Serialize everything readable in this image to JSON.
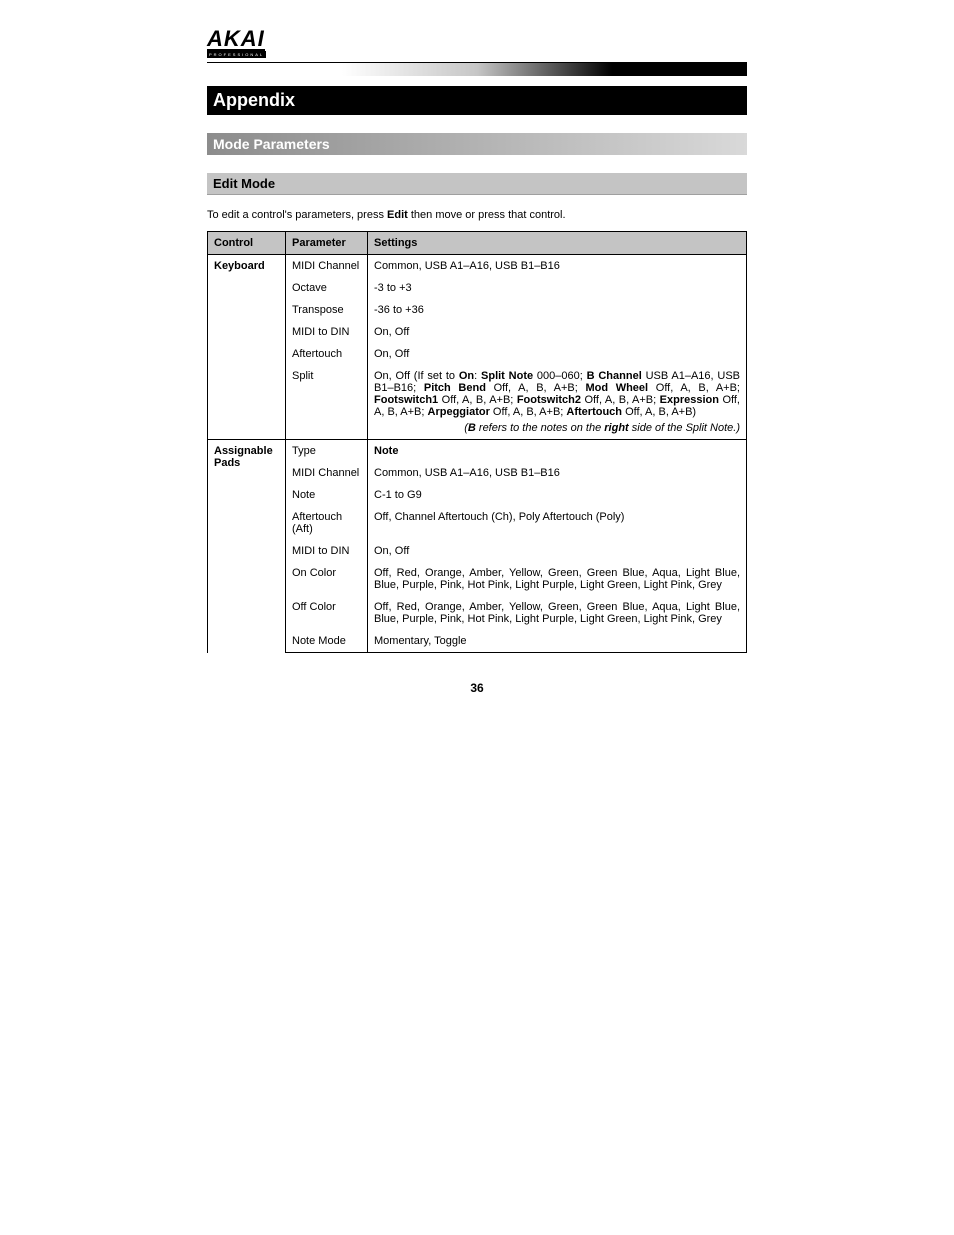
{
  "logo": {
    "main": "AKAI",
    "sub": "PROFESSIONAL"
  },
  "headings": {
    "appendix": "Appendix",
    "mode_parameters": "Mode Parameters",
    "edit_mode": "Edit Mode"
  },
  "intro": {
    "pre": "To edit a control's parameters, press ",
    "bold": "Edit",
    "post": " then move or press that control."
  },
  "table": {
    "headers": {
      "control": "Control",
      "parameter": "Parameter",
      "settings": "Settings"
    },
    "groups": [
      {
        "control": "Keyboard",
        "rows": [
          {
            "param": "MIDI Channel",
            "settings": "Common, USB A1–A16, USB B1–B16"
          },
          {
            "param": "Octave",
            "settings": "-3 to +3"
          },
          {
            "param": "Transpose",
            "settings": "-36 to +36"
          },
          {
            "param": "MIDI to DIN",
            "settings": "On, Off"
          },
          {
            "param": "Aftertouch",
            "settings": "On, Off"
          }
        ],
        "split": {
          "param": "Split",
          "segments": [
            {
              "t": "On, Off (If set to "
            },
            {
              "t": "On",
              "b": true
            },
            {
              "t": ": "
            },
            {
              "t": "Split Note",
              "b": true
            },
            {
              "t": " 000–060; "
            },
            {
              "t": "B Channel",
              "b": true
            },
            {
              "t": " USB A1–A16, USB B1–B16; "
            },
            {
              "t": "Pitch Bend",
              "b": true
            },
            {
              "t": " Off, A, B, A+B; "
            },
            {
              "t": "Mod Wheel",
              "b": true
            },
            {
              "t": " Off, A, B, A+B; "
            },
            {
              "t": "Footswitch1",
              "b": true
            },
            {
              "t": " Off, A, B, A+B; "
            },
            {
              "t": "Footswitch2",
              "b": true
            },
            {
              "t": " Off, A, B, A+B; "
            },
            {
              "t": "Expression",
              "b": true
            },
            {
              "t": " Off, A, B, A+B; "
            },
            {
              "t": "Arpeggiator",
              "b": true
            },
            {
              "t": " Off, A, B, A+B; "
            },
            {
              "t": "Aftertouch",
              "b": true
            },
            {
              "t": " Off, A, B, A+B)"
            }
          ],
          "note_segments": [
            {
              "t": "("
            },
            {
              "t": "B",
              "b": true
            },
            {
              "t": " refers to the notes on the "
            },
            {
              "t": "right",
              "b": true
            },
            {
              "t": " side of the Split Note.)"
            }
          ]
        }
      },
      {
        "control": "Assignable Pads",
        "rows": [
          {
            "param": "Type",
            "settings": "Note",
            "settings_bold": true
          },
          {
            "param": "MIDI Channel",
            "settings": "Common, USB A1–A16, USB B1–B16"
          },
          {
            "param": "Note",
            "settings": "C-1 to G9"
          },
          {
            "param": "Aftertouch (Aft)",
            "settings": "Off, Channel Aftertouch (Ch), Poly Aftertouch (Poly)"
          },
          {
            "param": "MIDI to DIN",
            "settings": "On, Off"
          },
          {
            "param": "On Color",
            "settings": "Off, Red, Orange, Amber, Yellow, Green, Green Blue, Aqua, Light Blue, Blue, Purple, Pink, Hot Pink, Light Purple, Light Green, Light Pink, Grey"
          },
          {
            "param": "Off Color",
            "settings": "Off, Red, Orange, Amber, Yellow, Green, Green Blue, Aqua, Light Blue, Blue, Purple, Pink, Hot Pink, Light Purple, Light Green, Light Pink, Grey"
          },
          {
            "param": "Note Mode",
            "settings": "Momentary, Toggle"
          }
        ]
      }
    ]
  },
  "page_number": "36"
}
